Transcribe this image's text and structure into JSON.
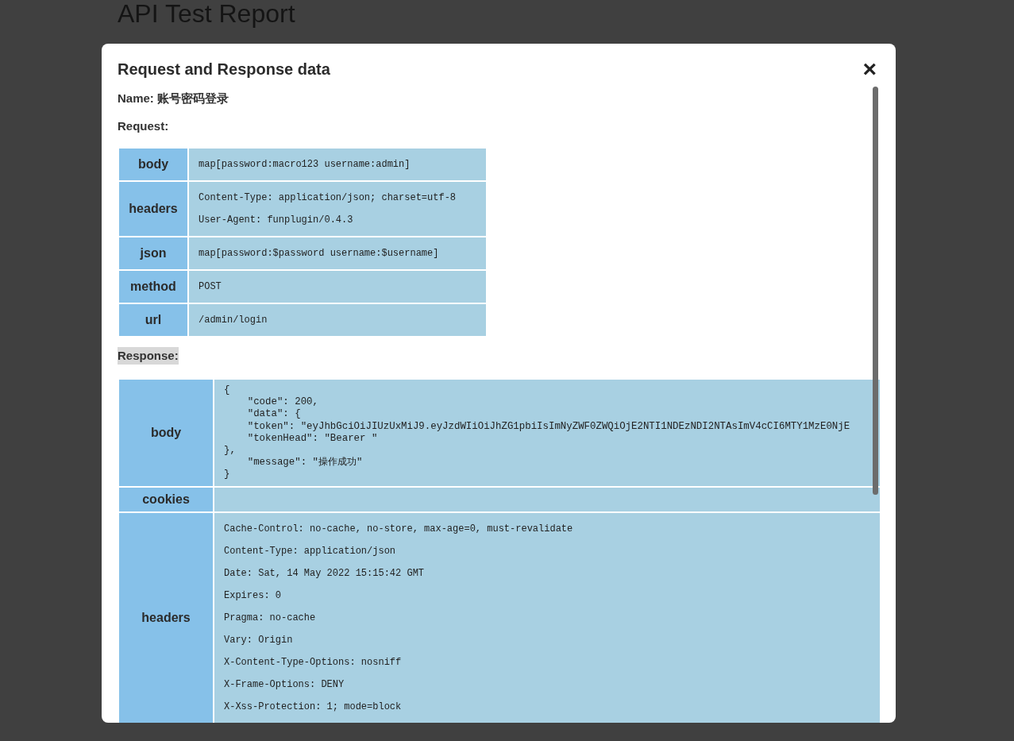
{
  "page": {
    "title": "API Test Report"
  },
  "modal": {
    "title": "Request and Response data",
    "close": "×",
    "name_line": "Name: 账号密码登录",
    "request_label": "Request:",
    "request": [
      {
        "key": "body",
        "lines": [
          "map[password:macro123 username:admin]"
        ]
      },
      {
        "key": "headers",
        "lines": [
          "Content-Type: application/json; charset=utf-8",
          "User-Agent: funplugin/0.4.3"
        ]
      },
      {
        "key": "json",
        "lines": [
          "map[password:$password username:$username]"
        ]
      },
      {
        "key": "method",
        "lines": [
          "POST"
        ]
      },
      {
        "key": "url",
        "lines": [
          "/admin/login"
        ]
      }
    ],
    "response_label": "Response:",
    "response": [
      {
        "key": "body",
        "kind": "pre",
        "text": "{\n    \"code\": 200,\n    \"data\": {\n    \"token\": \"eyJhbGciOiJIUzUxMiJ9.eyJzdWIiOiJhZG1pbiIsImNyZWF0ZWQiOjE2NTI1NDEzNDI2NTAsImV4cCI6MTY1MzE0NjE\n    \"tokenHead\": \"Bearer \"\n},\n    \"message\": \"操作成功\"\n}"
      },
      {
        "key": "cookies",
        "kind": "lines"
      },
      {
        "key": "headers",
        "kind": "lines",
        "lines": [
          "Cache-Control: no-cache, no-store, max-age=0, must-revalidate",
          "Content-Type: application/json",
          "Date: Sat, 14 May 2022 15:15:42 GMT",
          "Expires: 0",
          "Pragma: no-cache",
          "Vary: Origin",
          "X-Content-Type-Options: nosniff",
          "X-Frame-Options: DENY",
          "X-Xss-Protection: 1; mode=block"
        ]
      }
    ]
  }
}
